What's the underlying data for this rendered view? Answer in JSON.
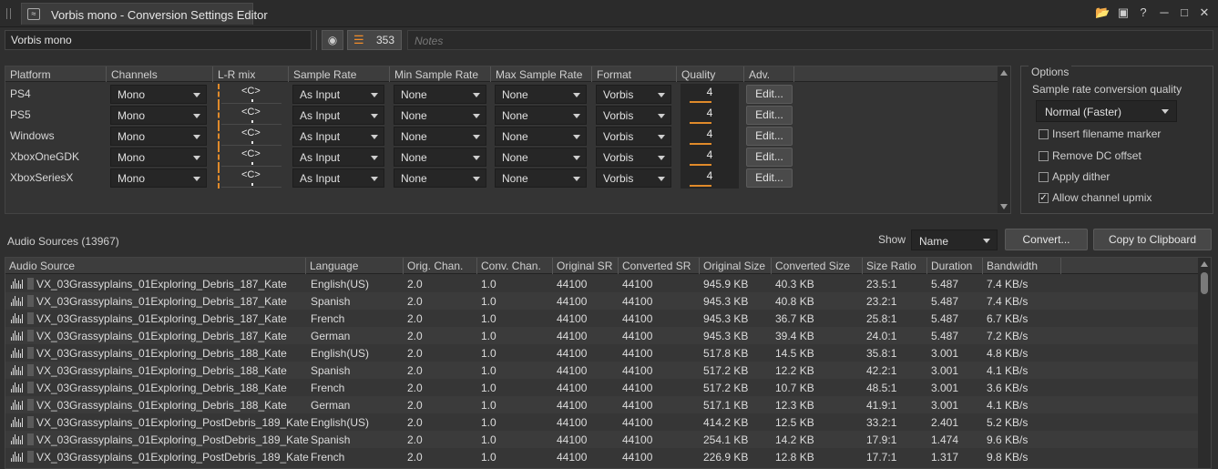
{
  "window": {
    "title": "Vorbis mono - Conversion Settings Editor",
    "tab_icon": "conversion-settings-icon",
    "buttons": [
      "folder-open-icon",
      "save-icon",
      "help-icon",
      "minimize-icon",
      "maximize-icon",
      "close-icon"
    ]
  },
  "settings": {
    "name": "Vorbis mono",
    "reference_count": "353",
    "notes_placeholder": "Notes"
  },
  "platform_table": {
    "headers": [
      "Platform",
      "Channels",
      "L-R mix",
      "Sample Rate",
      "Min Sample Rate",
      "Max Sample Rate",
      "Format",
      "Quality",
      "Adv."
    ],
    "rows": [
      {
        "platform": "PS4",
        "channels": "Mono",
        "lr_mix": "<C>",
        "sample_rate": "As Input",
        "min_sr": "None",
        "max_sr": "None",
        "format": "Vorbis",
        "quality": "4",
        "edit": "Edit..."
      },
      {
        "platform": "PS5",
        "channels": "Mono",
        "lr_mix": "<C>",
        "sample_rate": "As Input",
        "min_sr": "None",
        "max_sr": "None",
        "format": "Vorbis",
        "quality": "4",
        "edit": "Edit..."
      },
      {
        "platform": "Windows",
        "channels": "Mono",
        "lr_mix": "<C>",
        "sample_rate": "As Input",
        "min_sr": "None",
        "max_sr": "None",
        "format": "Vorbis",
        "quality": "4",
        "edit": "Edit..."
      },
      {
        "platform": "XboxOneGDK",
        "channels": "Mono",
        "lr_mix": "<C>",
        "sample_rate": "As Input",
        "min_sr": "None",
        "max_sr": "None",
        "format": "Vorbis",
        "quality": "4",
        "edit": "Edit..."
      },
      {
        "platform": "XboxSeriesX",
        "channels": "Mono",
        "lr_mix": "<C>",
        "sample_rate": "As Input",
        "min_sr": "None",
        "max_sr": "None",
        "format": "Vorbis",
        "quality": "4",
        "edit": "Edit..."
      }
    ]
  },
  "options": {
    "title": "Options",
    "src_quality_label": "Sample rate conversion quality",
    "src_quality_value": "Normal (Faster)",
    "checkboxes": [
      {
        "label": "Insert filename marker",
        "checked": false
      },
      {
        "label": "Remove DC offset",
        "checked": false
      },
      {
        "label": "Apply dither",
        "checked": false
      },
      {
        "label": "Allow channel upmix",
        "checked": true
      }
    ]
  },
  "audio_sources": {
    "title": "Audio Sources (13967)",
    "show_label": "Show",
    "show_value": "Name",
    "convert_label": "Convert...",
    "copy_label": "Copy to Clipboard",
    "headers": [
      "Audio Source",
      "Language",
      "Orig. Chan.",
      "Conv. Chan.",
      "Original SR",
      "Converted SR",
      "Original Size",
      "Converted Size",
      "Size Ratio",
      "Duration",
      "Bandwidth"
    ],
    "rows": [
      [
        "VX_03Grassyplains_01Exploring_Debris_187_Kate",
        "English(US)",
        "2.0",
        "1.0",
        "44100",
        "44100",
        "945.9 KB",
        "40.3 KB",
        "23.5:1",
        "5.487",
        "7.4 KB/s"
      ],
      [
        "VX_03Grassyplains_01Exploring_Debris_187_Kate",
        "Spanish",
        "2.0",
        "1.0",
        "44100",
        "44100",
        "945.3 KB",
        "40.8 KB",
        "23.2:1",
        "5.487",
        "7.4 KB/s"
      ],
      [
        "VX_03Grassyplains_01Exploring_Debris_187_Kate",
        "French",
        "2.0",
        "1.0",
        "44100",
        "44100",
        "945.3 KB",
        "36.7 KB",
        "25.8:1",
        "5.487",
        "6.7 KB/s"
      ],
      [
        "VX_03Grassyplains_01Exploring_Debris_187_Kate",
        "German",
        "2.0",
        "1.0",
        "44100",
        "44100",
        "945.3 KB",
        "39.4 KB",
        "24.0:1",
        "5.487",
        "7.2 KB/s"
      ],
      [
        "VX_03Grassyplains_01Exploring_Debris_188_Kate",
        "English(US)",
        "2.0",
        "1.0",
        "44100",
        "44100",
        "517.8 KB",
        "14.5 KB",
        "35.8:1",
        "3.001",
        "4.8 KB/s"
      ],
      [
        "VX_03Grassyplains_01Exploring_Debris_188_Kate",
        "Spanish",
        "2.0",
        "1.0",
        "44100",
        "44100",
        "517.2 KB",
        "12.2 KB",
        "42.2:1",
        "3.001",
        "4.1 KB/s"
      ],
      [
        "VX_03Grassyplains_01Exploring_Debris_188_Kate",
        "French",
        "2.0",
        "1.0",
        "44100",
        "44100",
        "517.2 KB",
        "10.7 KB",
        "48.5:1",
        "3.001",
        "3.6 KB/s"
      ],
      [
        "VX_03Grassyplains_01Exploring_Debris_188_Kate",
        "German",
        "2.0",
        "1.0",
        "44100",
        "44100",
        "517.1 KB",
        "12.3 KB",
        "41.9:1",
        "3.001",
        "4.1 KB/s"
      ],
      [
        "VX_03Grassyplains_01Exploring_PostDebris_189_Kate",
        "English(US)",
        "2.0",
        "1.0",
        "44100",
        "44100",
        "414.2 KB",
        "12.5 KB",
        "33.2:1",
        "2.401",
        "5.2 KB/s"
      ],
      [
        "VX_03Grassyplains_01Exploring_PostDebris_189_Kate",
        "Spanish",
        "2.0",
        "1.0",
        "44100",
        "44100",
        "254.1 KB",
        "14.2 KB",
        "17.9:1",
        "1.474",
        "9.6 KB/s"
      ],
      [
        "VX_03Grassyplains_01Exploring_PostDebris_189_Kate",
        "French",
        "2.0",
        "1.0",
        "44100",
        "44100",
        "226.9 KB",
        "12.8 KB",
        "17.7:1",
        "1.317",
        "9.8 KB/s"
      ]
    ]
  },
  "colors": {
    "accent": "#e08a2a",
    "background": "#2f2f2f"
  }
}
